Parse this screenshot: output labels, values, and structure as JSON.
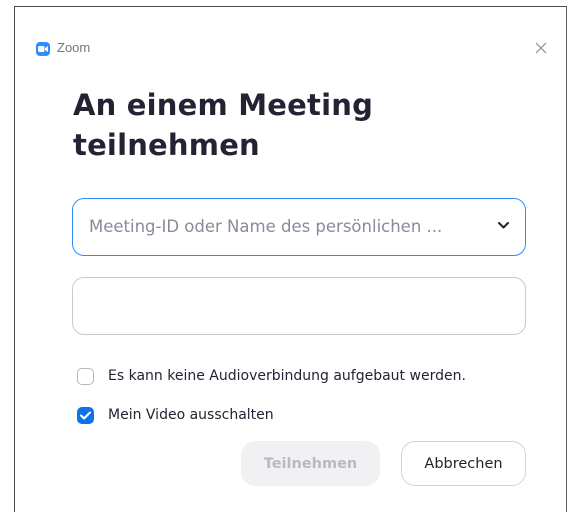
{
  "window": {
    "app_title": "Zoom",
    "app_icon": "zoom-camera-icon",
    "close_icon": "close-icon"
  },
  "dialog": {
    "heading": "An einem Meeting teilnehmen",
    "meeting_id_input": {
      "value": "",
      "placeholder": "Meeting-ID oder Name des persönlichen ..."
    },
    "dropdown_icon": "chevron-down-icon",
    "name_input": {
      "value": "",
      "placeholder": ""
    },
    "options": [
      {
        "label": "Es kann keine Audioverbindung aufgebaut werden.",
        "checked": false
      },
      {
        "label": "Mein Video ausschalten",
        "checked": true
      }
    ],
    "join_button": "Teilnehmen",
    "join_enabled": false,
    "cancel_button": "Abbrechen"
  },
  "colors": {
    "accent": "#0e72ed",
    "focus_border": "#2d8cff",
    "text": "#232333",
    "muted_text": "#747487",
    "disabled_button_bg": "#f1f1f4",
    "disabled_button_text": "#b9b9c4"
  }
}
